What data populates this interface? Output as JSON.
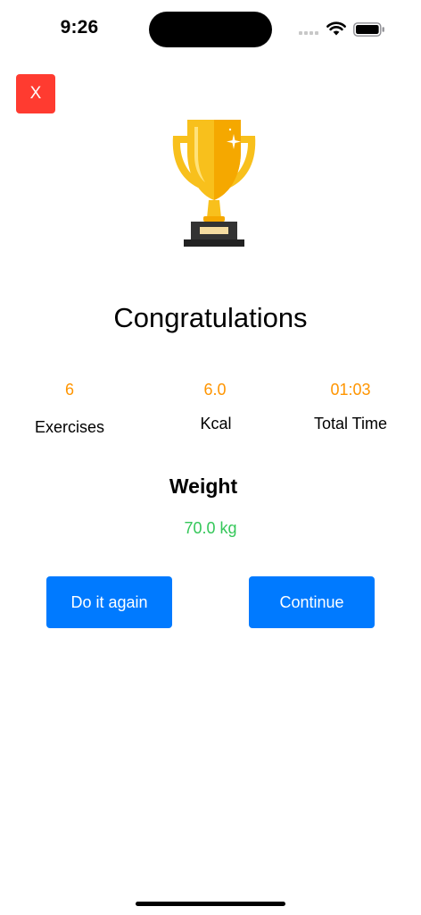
{
  "status_bar": {
    "time": "9:26"
  },
  "close_button": {
    "label": "X"
  },
  "page": {
    "title": "Congratulations"
  },
  "stats": [
    {
      "value": "6",
      "label": "Exercises"
    },
    {
      "value": "6.0",
      "label": "Kcal"
    },
    {
      "value": "01:03",
      "label": "Total Time"
    }
  ],
  "weight": {
    "title": "Weight",
    "value": "70.0 kg"
  },
  "buttons": {
    "again_label": "Do it again",
    "continue_label": "Continue"
  },
  "colors": {
    "close": "#ff3b30",
    "accent": "#007aff",
    "stat_value": "#ff9500",
    "weight_value": "#34c759",
    "trophy_gold": "#f8c01c"
  },
  "icons": {
    "trophy": "trophy-icon",
    "wifi": "wifi-icon",
    "battery": "battery-icon",
    "signal": "cellular-signal-icon"
  }
}
